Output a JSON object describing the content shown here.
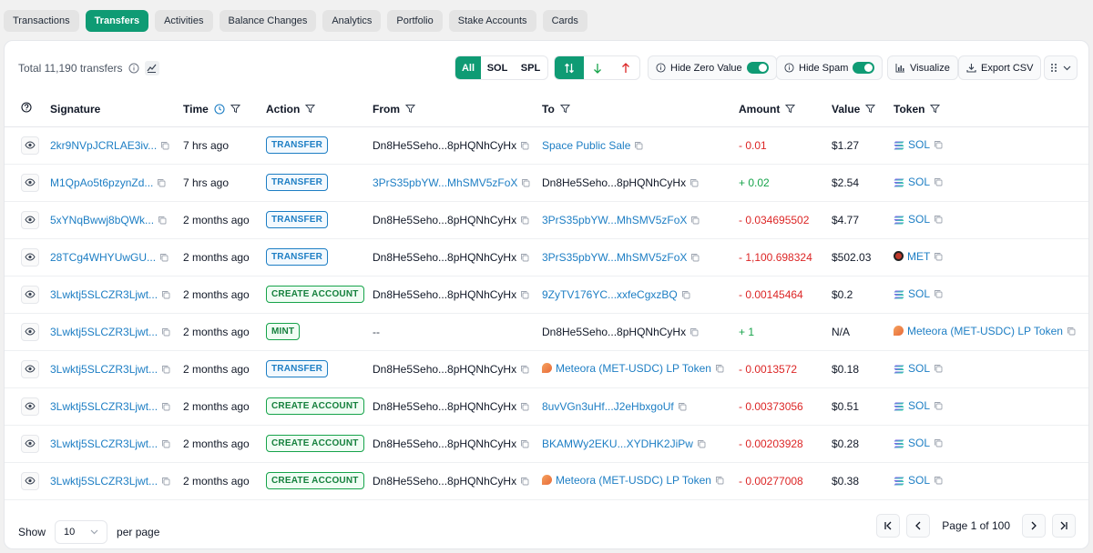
{
  "tabs": [
    "Transactions",
    "Transfers",
    "Activities",
    "Balance Changes",
    "Analytics",
    "Portfolio",
    "Stake Accounts",
    "Cards"
  ],
  "active_tab": "Transfers",
  "toolbar": {
    "total_text": "Total 11,190 transfers",
    "filter_all": "All",
    "filter_sol": "SOL",
    "filter_spl": "SPL",
    "hide_zero_label": "Hide Zero Value",
    "hide_spam_label": "Hide Spam",
    "visualize_label": "Visualize",
    "export_label": "Export CSV"
  },
  "columns": {
    "signature": "Signature",
    "time": "Time",
    "action": "Action",
    "from": "From",
    "to": "To",
    "amount": "Amount",
    "value": "Value",
    "token": "Token"
  },
  "rows": [
    {
      "signature": "2kr9NVpJCRLAE3iv...",
      "time": "7 hrs ago",
      "action": "TRANSFER",
      "action_type": "transfer",
      "from": "Dn8He5Seho...8pHQNhCyHx",
      "from_link": false,
      "to": "Space Public Sale",
      "to_link": true,
      "to_lp": false,
      "amount": "- 0.01",
      "sign": "neg",
      "value": "$1.27",
      "token": "SOL",
      "token_icon": "sol"
    },
    {
      "signature": "M1QpAo5t6pzynZd...",
      "time": "7 hrs ago",
      "action": "TRANSFER",
      "action_type": "transfer",
      "from": "3PrS35pbYW...MhSMV5zFoX",
      "from_link": true,
      "to": "Dn8He5Seho...8pHQNhCyHx",
      "to_link": false,
      "to_lp": false,
      "amount": "+ 0.02",
      "sign": "pos",
      "value": "$2.54",
      "token": "SOL",
      "token_icon": "sol"
    },
    {
      "signature": "5xYNqBwwj8bQWk...",
      "time": "2 months ago",
      "action": "TRANSFER",
      "action_type": "transfer",
      "from": "Dn8He5Seho...8pHQNhCyHx",
      "from_link": false,
      "to": "3PrS35pbYW...MhSMV5zFoX",
      "to_link": true,
      "to_lp": false,
      "amount": "- 0.034695502",
      "sign": "neg",
      "value": "$4.77",
      "token": "SOL",
      "token_icon": "sol"
    },
    {
      "signature": "28TCg4WHYUwGU...",
      "time": "2 months ago",
      "action": "TRANSFER",
      "action_type": "transfer",
      "from": "Dn8He5Seho...8pHQNhCyHx",
      "from_link": false,
      "to": "3PrS35pbYW...MhSMV5zFoX",
      "to_link": true,
      "to_lp": false,
      "amount": "- 1,100.698324",
      "sign": "neg",
      "value": "$502.03",
      "token": "MET",
      "token_icon": "met"
    },
    {
      "signature": "3Lwktj5SLCZR3Ljwt...",
      "time": "2 months ago",
      "action": "CREATE ACCOUNT",
      "action_type": "create",
      "from": "Dn8He5Seho...8pHQNhCyHx",
      "from_link": false,
      "to": "9ZyTV176YC...xxfeCgxzBQ",
      "to_link": true,
      "to_lp": false,
      "amount": "- 0.00145464",
      "sign": "neg",
      "value": "$0.2",
      "token": "SOL",
      "token_icon": "sol"
    },
    {
      "signature": "3Lwktj5SLCZR3Ljwt...",
      "time": "2 months ago",
      "action": "MINT",
      "action_type": "mint",
      "from": "--",
      "from_link": false,
      "to": "Dn8He5Seho...8pHQNhCyHx",
      "to_link": false,
      "to_lp": false,
      "amount": "+ 1",
      "sign": "pos",
      "value": "N/A",
      "token": "Meteora (MET-USDC) LP Token",
      "token_icon": "lp"
    },
    {
      "signature": "3Lwktj5SLCZR3Ljwt...",
      "time": "2 months ago",
      "action": "TRANSFER",
      "action_type": "transfer",
      "from": "Dn8He5Seho...8pHQNhCyHx",
      "from_link": false,
      "to": "Meteora (MET-USDC) LP Token",
      "to_link": true,
      "to_lp": true,
      "amount": "- 0.0013572",
      "sign": "neg",
      "value": "$0.18",
      "token": "SOL",
      "token_icon": "sol"
    },
    {
      "signature": "3Lwktj5SLCZR3Ljwt...",
      "time": "2 months ago",
      "action": "CREATE ACCOUNT",
      "action_type": "create",
      "from": "Dn8He5Seho...8pHQNhCyHx",
      "from_link": false,
      "to": "8uvVGn3uHf...J2eHbxgoUf",
      "to_link": true,
      "to_lp": false,
      "amount": "- 0.00373056",
      "sign": "neg",
      "value": "$0.51",
      "token": "SOL",
      "token_icon": "sol"
    },
    {
      "signature": "3Lwktj5SLCZR3Ljwt...",
      "time": "2 months ago",
      "action": "CREATE ACCOUNT",
      "action_type": "create",
      "from": "Dn8He5Seho...8pHQNhCyHx",
      "from_link": false,
      "to": "BKAMWy2EKU...XYDHK2JiPw",
      "to_link": true,
      "to_lp": false,
      "amount": "- 0.00203928",
      "sign": "neg",
      "value": "$0.28",
      "token": "SOL",
      "token_icon": "sol"
    },
    {
      "signature": "3Lwktj5SLCZR3Ljwt...",
      "time": "2 months ago",
      "action": "CREATE ACCOUNT",
      "action_type": "create",
      "from": "Dn8He5Seho...8pHQNhCyHx",
      "from_link": false,
      "to": "Meteora (MET-USDC) LP Token",
      "to_link": true,
      "to_lp": true,
      "amount": "- 0.00277008",
      "sign": "neg",
      "value": "$0.38",
      "token": "SOL",
      "token_icon": "sol"
    }
  ],
  "footer": {
    "show_label": "Show",
    "page_size": "10",
    "per_page_label": "per page",
    "page_info": "Page 1 of 100"
  },
  "colors": {
    "accent": "#0f9b74",
    "link": "#1d7ec4",
    "negative": "#dc2626",
    "positive": "#16a34a"
  }
}
